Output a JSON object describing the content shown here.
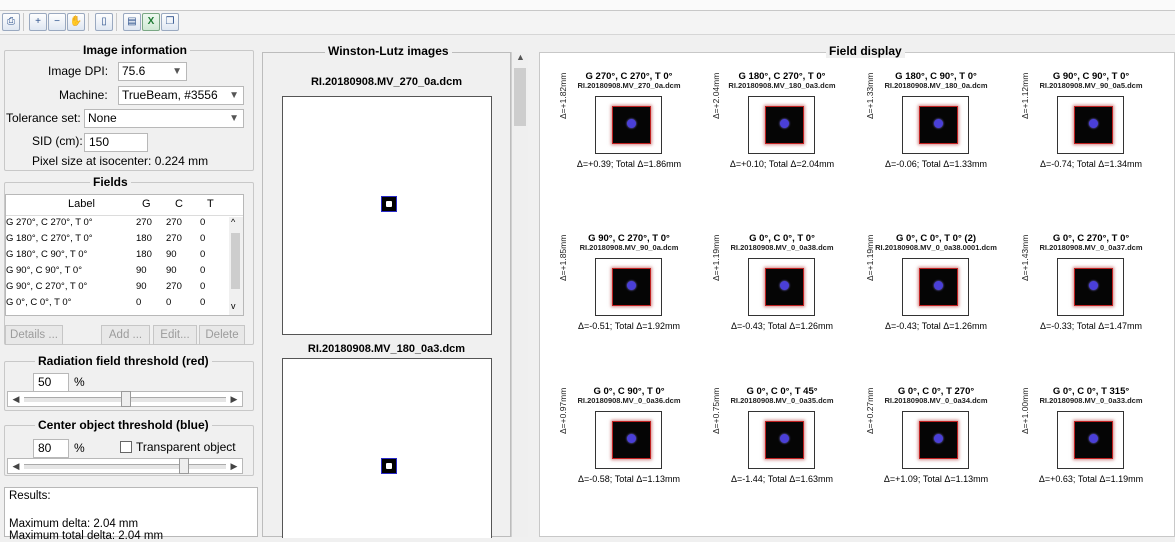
{
  "toolbar": {
    "icons": [
      "print-icon",
      "zoom-in-icon",
      "zoom-out-icon",
      "pan-hand-icon",
      "rectangle-icon",
      "report-icon",
      "excel-export-icon",
      "clipboard-icon"
    ]
  },
  "image_info": {
    "title": "Image information",
    "dpi_label": "Image DPI:",
    "dpi_value": "75.6",
    "machine_label": "Machine:",
    "machine_value": "TrueBeam, #3556",
    "tolerance_label": "Tolerance set:",
    "tolerance_value": "None",
    "sid_label": "SID (cm):",
    "sid_value": "150",
    "pixel_size_text": "Pixel size at isocenter: 0.224 mm"
  },
  "fields": {
    "title": "Fields",
    "columns": [
      "Label",
      "G",
      "C",
      "T"
    ],
    "rows": [
      {
        "label": "G 270°, C 270°, T 0°",
        "g": "270",
        "c": "270",
        "t": "0"
      },
      {
        "label": "G 180°, C 270°, T 0°",
        "g": "180",
        "c": "270",
        "t": "0"
      },
      {
        "label": "G 180°, C 90°, T 0°",
        "g": "180",
        "c": "90",
        "t": "0"
      },
      {
        "label": "G 90°, C 90°, T 0°",
        "g": "90",
        "c": "90",
        "t": "0"
      },
      {
        "label": "G 90°, C 270°, T 0°",
        "g": "90",
        "c": "270",
        "t": "0"
      },
      {
        "label": "G 0°, C 0°, T 0°",
        "g": "0",
        "c": "0",
        "t": "0"
      }
    ],
    "buttons": {
      "details": "Details ...",
      "add": "Add ...",
      "edit": "Edit...",
      "delete": "Delete"
    }
  },
  "radiation_threshold": {
    "title": "Radiation field threshold (red)",
    "value": "50",
    "unit": "%",
    "level": 0.5
  },
  "center_threshold": {
    "title": "Center object threshold (blue)",
    "value": "80",
    "unit": "%",
    "transparent_label": "Transparent object",
    "level": 0.8
  },
  "results": {
    "heading": "Results:",
    "max_delta": "Maximum delta: 2.04 mm",
    "max_total_delta": "Maximum total delta: 2.04 mm"
  },
  "wl_images": {
    "title": "Winston-Lutz images",
    "items": [
      {
        "file": "RI.20180908.MV_270_0a.dcm"
      },
      {
        "file": "RI.20180908.MV_180_0a3.dcm"
      }
    ]
  },
  "field_display": {
    "title": "Field display",
    "cells": [
      {
        "title": "G 270°, C 270°, T 0°",
        "file": "RI.20180908.MV_270_0a.dcm",
        "vertical": "Δ=+1.82mm",
        "summary": "Δ=+0.39; Total Δ=1.86mm"
      },
      {
        "title": "G 180°, C 270°, T 0°",
        "file": "RI.20180908.MV_180_0a3.dcm",
        "vertical": "Δ=+2.04mm",
        "summary": "Δ=+0.10; Total Δ=2.04mm"
      },
      {
        "title": "G 180°, C 90°, T 0°",
        "file": "RI.20180908.MV_180_0a.dcm",
        "vertical": "Δ=+1.33mm",
        "summary": "Δ=-0.06; Total Δ=1.33mm"
      },
      {
        "title": "G 90°, C 90°, T 0°",
        "file": "RI.20180908.MV_90_0a5.dcm",
        "vertical": "Δ=+1.12mm",
        "summary": "Δ=-0.74; Total Δ=1.34mm"
      },
      {
        "title": "G 90°, C 270°, T 0°",
        "file": "RI.20180908.MV_90_0a.dcm",
        "vertical": "Δ=+1.85mm",
        "summary": "Δ=-0.51; Total Δ=1.92mm"
      },
      {
        "title": "G 0°, C 0°, T 0°",
        "file": "RI.20180908.MV_0_0a38.dcm",
        "vertical": "Δ=+1.19mm",
        "summary": "Δ=-0.43; Total Δ=1.26mm"
      },
      {
        "title": "G 0°, C 0°, T 0° (2)",
        "file": "RI.20180908.MV_0_0a38.0001.dcm",
        "vertical": "Δ=+1.19mm",
        "summary": "Δ=-0.43; Total Δ=1.26mm"
      },
      {
        "title": "G 0°, C 270°, T 0°",
        "file": "RI.20180908.MV_0_0a37.dcm",
        "vertical": "Δ=+1.43mm",
        "summary": "Δ=-0.33; Total Δ=1.47mm"
      },
      {
        "title": "G 0°, C 90°, T 0°",
        "file": "RI.20180908.MV_0_0a36.dcm",
        "vertical": "Δ=+0.97mm",
        "summary": "Δ=-0.58; Total Δ=1.13mm"
      },
      {
        "title": "G 0°, C 0°, T 45°",
        "file": "RI.20180908.MV_0_0a35.dcm",
        "vertical": "Δ=+0.75mm",
        "summary": "Δ=-1.44; Total Δ=1.63mm"
      },
      {
        "title": "G 0°, C 0°, T 270°",
        "file": "RI.20180908.MV_0_0a34.dcm",
        "vertical": "Δ=+0.27mm",
        "summary": "Δ=+1.09; Total Δ=1.13mm"
      },
      {
        "title": "G 0°, C 0°, T 315°",
        "file": "RI.20180908.MV_0_0a33.dcm",
        "vertical": "Δ=+1.00mm",
        "summary": "Δ=+0.63; Total Δ=1.19mm"
      }
    ]
  }
}
